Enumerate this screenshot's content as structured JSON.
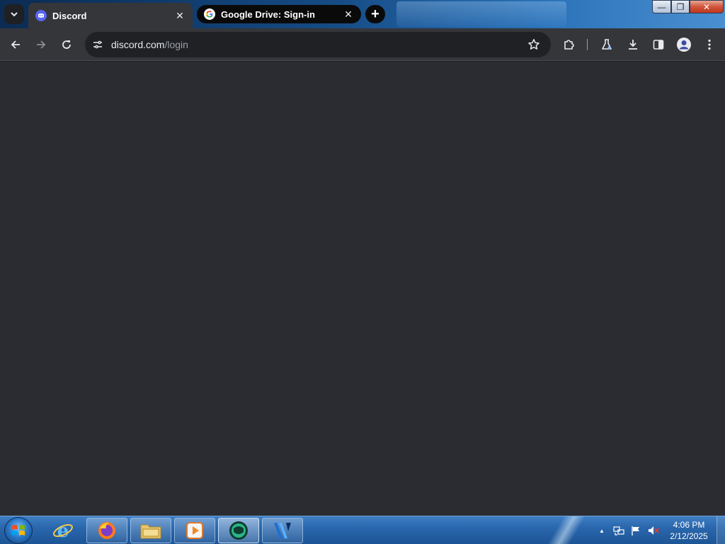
{
  "browser": {
    "tabs": [
      {
        "title": "Discord",
        "favicon": "discord-icon",
        "active": true
      },
      {
        "title": "Google Drive: Sign-in",
        "favicon": "google-icon",
        "active": false
      }
    ],
    "new_tab_label": "+",
    "close_glyph": "✕"
  },
  "toolbar": {
    "url_host": "discord.com",
    "url_path": "/login",
    "icons": [
      "back-icon",
      "forward-icon",
      "reload-icon",
      "site-info-icon",
      "bookmark-star-icon",
      "extensions-icon",
      "labs-icon",
      "download-icon",
      "side-panel-icon",
      "profile-icon",
      "menu-icon"
    ]
  },
  "window": {
    "min_glyph": "—",
    "max_glyph": "❐",
    "close_glyph": "✕"
  },
  "taskbar": {
    "pinned": [
      "internet-explorer-icon",
      "firefox-icon",
      "file-explorer-icon",
      "media-player-icon",
      "app-icon",
      "video-editor-icon"
    ],
    "tray_expand": "▲",
    "clock_time": "4:06 PM",
    "clock_date": "2/12/2025"
  },
  "colors": {
    "discord_brand": "#5865F2",
    "content_bg": "#2b2c31",
    "toolbar_bg": "#35363a"
  }
}
